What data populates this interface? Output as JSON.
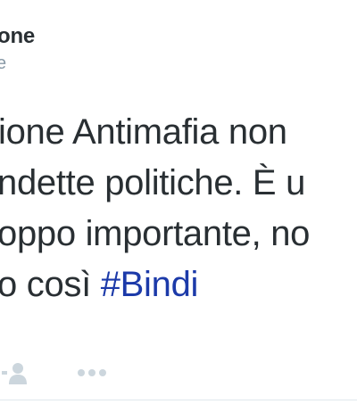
{
  "tweet": {
    "author_name": "one",
    "author_handle": "e",
    "text_lines": [
      "ione Antimafia non",
      "ndette politiche. È u",
      "oppo importante, no",
      "o così "
    ],
    "hashtag": "#Bindi",
    "actions": {
      "follow_icon": "person-plus-icon",
      "more_icon": "more-dots-icon"
    },
    "colors": {
      "text": "#292f33",
      "muted": "#8899a6",
      "hashtag": "#1c3aa9",
      "icon": "#ccd6dd"
    }
  }
}
